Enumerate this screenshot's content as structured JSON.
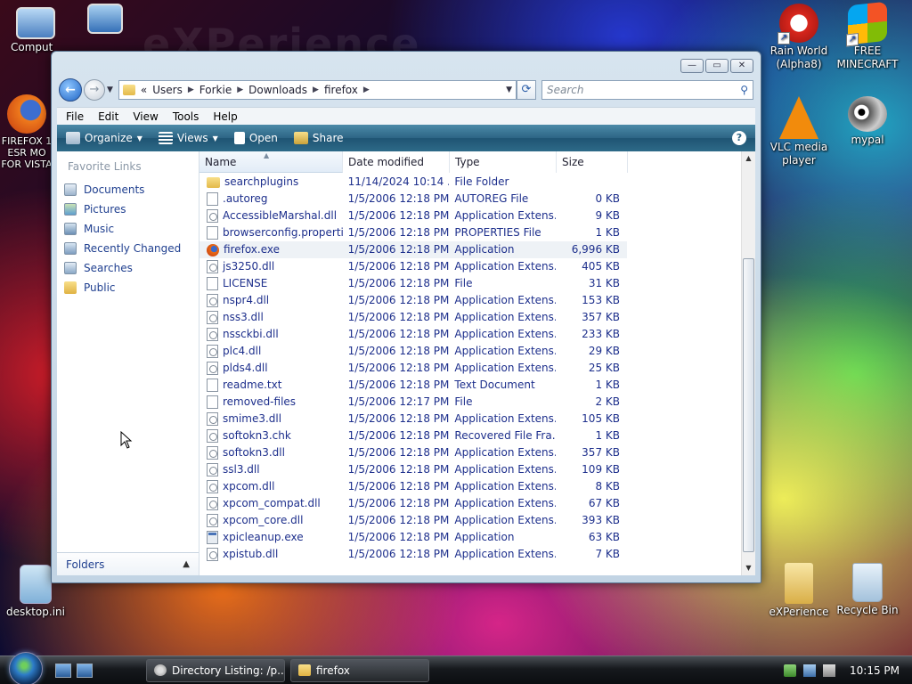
{
  "desktop": {
    "watermark": "eXPerience",
    "icons_left": [
      {
        "label": "Comput"
      },
      {
        "label": ""
      },
      {
        "label": "FIREFOX 1\nESR MO\nFOR VISTA"
      },
      {
        "label": "desktop.ini"
      }
    ],
    "icons_right": [
      {
        "label": "Rain World (Alpha8)"
      },
      {
        "label": "FREE MINECRAFT"
      },
      {
        "label": "VLC media player"
      },
      {
        "label": "mypal"
      },
      {
        "label": "eXPerience"
      },
      {
        "label": "Recycle Bin"
      }
    ]
  },
  "window": {
    "controls": {
      "minimize": "—",
      "maximize": "▭",
      "close": "✕"
    },
    "breadcrumb": {
      "overflow": "«",
      "parts": [
        "Users",
        "Forkie",
        "Downloads",
        "firefox"
      ]
    },
    "search_placeholder": "Search",
    "menu": [
      "File",
      "Edit",
      "View",
      "Tools",
      "Help"
    ],
    "toolbar": {
      "organize": "Organize",
      "views": "Views",
      "open": "Open",
      "share": "Share"
    },
    "favorites": {
      "title": "Favorite Links",
      "items": [
        "Documents",
        "Pictures",
        "Music",
        "Recently Changed",
        "Searches",
        "Public"
      ]
    },
    "folders_label": "Folders",
    "columns": {
      "name": "Name",
      "date": "Date modified",
      "type": "Type",
      "size": "Size"
    },
    "files": [
      {
        "name": "searchplugins",
        "date": "11/14/2024 10:14 ...",
        "type": "File Folder",
        "size": "",
        "icon": "folder"
      },
      {
        "name": ".autoreg",
        "date": "1/5/2006 12:18 PM",
        "type": "AUTOREG File",
        "size": "0 KB",
        "icon": "file"
      },
      {
        "name": "AccessibleMarshal.dll",
        "date": "1/5/2006 12:18 PM",
        "type": "Application Extens...",
        "size": "9 KB",
        "icon": "dll"
      },
      {
        "name": "browserconfig.properti...",
        "date": "1/5/2006 12:18 PM",
        "type": "PROPERTIES File",
        "size": "1 KB",
        "icon": "file"
      },
      {
        "name": "firefox.exe",
        "date": "1/5/2006 12:18 PM",
        "type": "Application",
        "size": "6,996 KB",
        "icon": "fox"
      },
      {
        "name": "js3250.dll",
        "date": "1/5/2006 12:18 PM",
        "type": "Application Extens...",
        "size": "405 KB",
        "icon": "dll"
      },
      {
        "name": "LICENSE",
        "date": "1/5/2006 12:18 PM",
        "type": "File",
        "size": "31 KB",
        "icon": "file"
      },
      {
        "name": "nspr4.dll",
        "date": "1/5/2006 12:18 PM",
        "type": "Application Extens...",
        "size": "153 KB",
        "icon": "dll"
      },
      {
        "name": "nss3.dll",
        "date": "1/5/2006 12:18 PM",
        "type": "Application Extens...",
        "size": "357 KB",
        "icon": "dll"
      },
      {
        "name": "nssckbi.dll",
        "date": "1/5/2006 12:18 PM",
        "type": "Application Extens...",
        "size": "233 KB",
        "icon": "dll"
      },
      {
        "name": "plc4.dll",
        "date": "1/5/2006 12:18 PM",
        "type": "Application Extens...",
        "size": "29 KB",
        "icon": "dll"
      },
      {
        "name": "plds4.dll",
        "date": "1/5/2006 12:18 PM",
        "type": "Application Extens...",
        "size": "25 KB",
        "icon": "dll"
      },
      {
        "name": "readme.txt",
        "date": "1/5/2006 12:18 PM",
        "type": "Text Document",
        "size": "1 KB",
        "icon": "file"
      },
      {
        "name": "removed-files",
        "date": "1/5/2006 12:17 PM",
        "type": "File",
        "size": "2 KB",
        "icon": "file"
      },
      {
        "name": "smime3.dll",
        "date": "1/5/2006 12:18 PM",
        "type": "Application Extens...",
        "size": "105 KB",
        "icon": "dll"
      },
      {
        "name": "softokn3.chk",
        "date": "1/5/2006 12:18 PM",
        "type": "Recovered File Fra...",
        "size": "1 KB",
        "icon": "dll"
      },
      {
        "name": "softokn3.dll",
        "date": "1/5/2006 12:18 PM",
        "type": "Application Extens...",
        "size": "357 KB",
        "icon": "dll"
      },
      {
        "name": "ssl3.dll",
        "date": "1/5/2006 12:18 PM",
        "type": "Application Extens...",
        "size": "109 KB",
        "icon": "dll"
      },
      {
        "name": "xpcom.dll",
        "date": "1/5/2006 12:18 PM",
        "type": "Application Extens...",
        "size": "8 KB",
        "icon": "dll"
      },
      {
        "name": "xpcom_compat.dll",
        "date": "1/5/2006 12:18 PM",
        "type": "Application Extens...",
        "size": "67 KB",
        "icon": "dll"
      },
      {
        "name": "xpcom_core.dll",
        "date": "1/5/2006 12:18 PM",
        "type": "Application Extens...",
        "size": "393 KB",
        "icon": "dll"
      },
      {
        "name": "xpicleanup.exe",
        "date": "1/5/2006 12:18 PM",
        "type": "Application",
        "size": "63 KB",
        "icon": "app"
      },
      {
        "name": "xpistub.dll",
        "date": "1/5/2006 12:18 PM",
        "type": "Application Extens...",
        "size": "7 KB",
        "icon": "dll"
      }
    ],
    "selected_index": 4
  },
  "taskbar": {
    "tasks": [
      {
        "label": "Directory Listing: /p..."
      },
      {
        "label": "firefox"
      }
    ],
    "clock": "10:15 PM"
  },
  "colors": {
    "link_blue": "#1d2f8c",
    "toolbar_teal": "#2d6585"
  }
}
